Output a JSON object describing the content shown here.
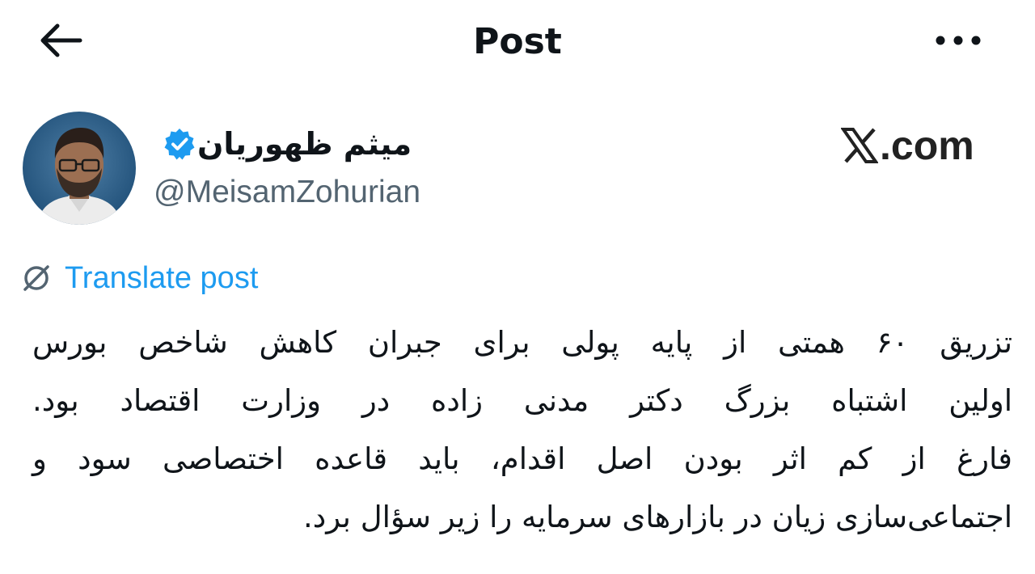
{
  "header": {
    "title": "Post",
    "back_icon": "arrow-left-icon",
    "more_icon": "more-horizontal-icon"
  },
  "author": {
    "display_name": "میثم ظهوریان",
    "handle": "@MeisamZohurian",
    "verified": true,
    "verified_color": "#1d9bf0"
  },
  "watermark": {
    "text": ".com",
    "logo_icon": "x-logo-icon"
  },
  "translate": {
    "label": "Translate post",
    "icon": "translate-icon",
    "color": "#1d9bf0"
  },
  "post": {
    "lines": [
      "تزریق ۶۰ همتی از پایه پولی برای جبران کاهش شاخص بورس",
      "اولین اشتباه بزرگ دکتر مدنی زاده در وزارت اقتصاد بود.",
      "فارغ از کم اثر بودن اصل اقدام، باید قاعده اختصاصی سود و",
      "اجتماعی‌سازی زیان در بازارهای سرمایه را زیر سؤال برد."
    ]
  }
}
